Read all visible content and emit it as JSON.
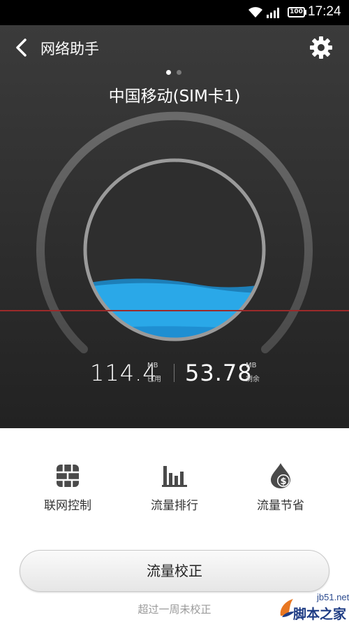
{
  "status_bar": {
    "battery": "100",
    "time": "17:24"
  },
  "header": {
    "title": "网络助手",
    "back_icon": "chevron-left-icon",
    "settings_icon": "gear-icon"
  },
  "carrier": {
    "name": "中国移动(SIM卡1)",
    "pages": 2,
    "active_page": 1
  },
  "gauge": {
    "fill_fraction": 0.32,
    "water_color": "#2aa8e8"
  },
  "usage": {
    "used_value": "114.4",
    "used_unit": "MB",
    "used_label": "已用",
    "remaining_value": "53.78",
    "remaining_unit": "MB",
    "remaining_label": "剩余"
  },
  "features": [
    {
      "label": "联网控制",
      "icon": "firewall-icon"
    },
    {
      "label": "流量排行",
      "icon": "bar-chart-icon"
    },
    {
      "label": "流量节省",
      "icon": "money-drop-icon"
    }
  ],
  "calibrate": {
    "button_label": "流量校正",
    "hint": "超过一周未校正"
  },
  "watermark": {
    "site": "jb51.net",
    "name": "脚本之家"
  },
  "colors": {
    "accent_water": "#2aa8e8",
    "panel_dark": "#2e2e2e",
    "red_line": "#9b2a2a"
  }
}
